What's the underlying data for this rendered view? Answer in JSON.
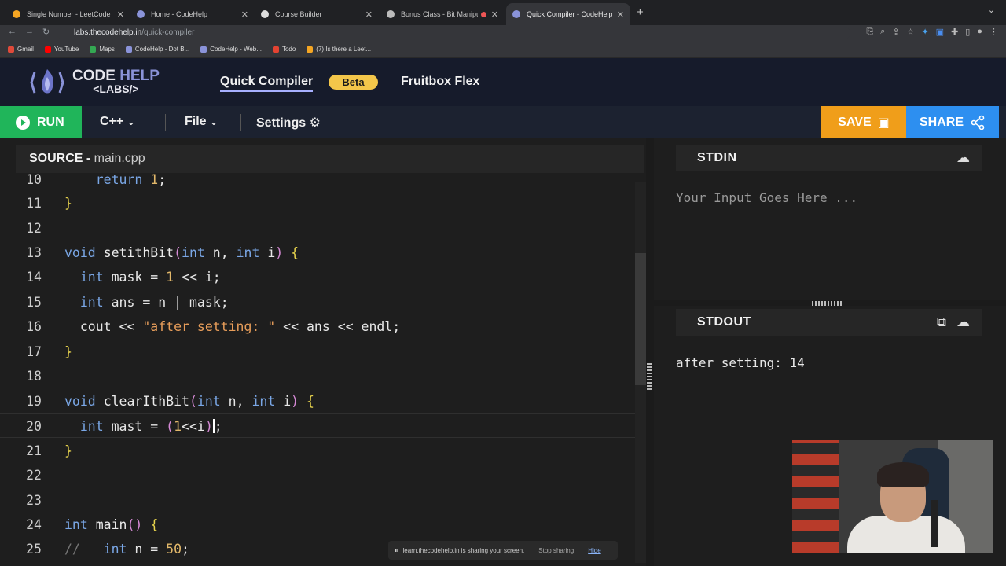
{
  "browser": {
    "tabs": [
      {
        "title": "Single Number - LeetCode",
        "active": false
      },
      {
        "title": "Home - CodeHelp",
        "active": false
      },
      {
        "title": "Course Builder",
        "active": false
      },
      {
        "title": "Bonus Class - Bit Manipula",
        "active": false
      },
      {
        "title": "Quick Compiler - CodeHelp La",
        "active": true
      }
    ],
    "new_tab_icon": "plus-icon",
    "url_host": "labs.thecodehelp.in",
    "url_path": "/quick-compiler",
    "bookmarks": [
      "Gmail",
      "YouTube",
      "Maps",
      "CodeHelp - Dot B...",
      "CodeHelp - Web...",
      "Todo",
      "(7) Is there a Leet..."
    ]
  },
  "app": {
    "logo_main": "CODE",
    "logo_accent": "HELP",
    "logo_sub": "<LABS/>",
    "nav": {
      "quick_compiler": "Quick Compiler",
      "beta": "Beta",
      "fruitbox": "Fruitbox Flex"
    },
    "toolbar": {
      "run": "RUN",
      "language": "C++",
      "file": "File",
      "settings": "Settings",
      "save": "SAVE",
      "share": "SHARE"
    },
    "source_label": "SOURCE - ",
    "source_file": "main.cpp",
    "stdin_label": "STDIN",
    "stdin_placeholder": "Your Input Goes Here ...",
    "stdout_label": "STDOUT",
    "stdout_text": "after setting: 14"
  },
  "code": {
    "line_numbers": [
      "10",
      "11",
      "12",
      "13",
      "14",
      "15",
      "16",
      "17",
      "18",
      "19",
      "20",
      "21",
      "22",
      "23",
      "24",
      "25"
    ],
    "current_line": "20"
  },
  "share_notice": {
    "message": "learn.thecodehelp.in is sharing your screen.",
    "stop": "Stop sharing",
    "hide": "Hide"
  },
  "colors": {
    "run_green": "#20b55a",
    "save_orange": "#f09e1a",
    "share_blue": "#2d8ff0",
    "beta_yellow": "#f3c64a",
    "header_navy": "#161b2b"
  }
}
